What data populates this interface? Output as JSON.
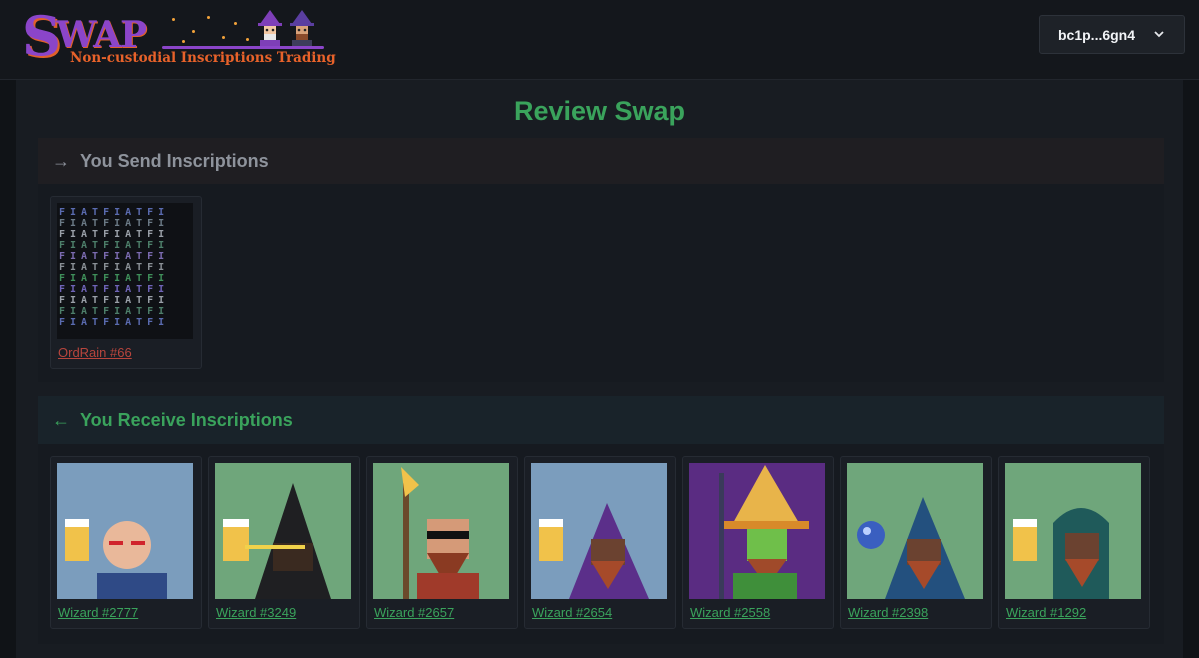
{
  "header": {
    "logo_word": "SWAP",
    "logo_tagline": "Non-custodial Inscriptions Trading",
    "wallet_label": "bc1p...6gn4"
  },
  "page_title": "Review Swap",
  "send": {
    "heading": "You Send Inscriptions",
    "items": [
      {
        "name": "OrdRain #66",
        "art_text": "FIATFIATFI"
      }
    ]
  },
  "receive": {
    "heading": "You Receive Inscriptions",
    "items": [
      {
        "name": "Wizard #2777",
        "bg": "#7b9dbd"
      },
      {
        "name": "Wizard #3249",
        "bg": "#6fa67b"
      },
      {
        "name": "Wizard #2657",
        "bg": "#6fa67b"
      },
      {
        "name": "Wizard #2654",
        "bg": "#7b9dbd"
      },
      {
        "name": "Wizard #2558",
        "bg": "#5a2c82"
      },
      {
        "name": "Wizard #2398",
        "bg": "#6fa67b"
      },
      {
        "name": "Wizard #1292",
        "bg": "#6fa67b"
      }
    ]
  },
  "colors": {
    "accent_green": "#3aa35c",
    "send_red": "#b8453d"
  }
}
